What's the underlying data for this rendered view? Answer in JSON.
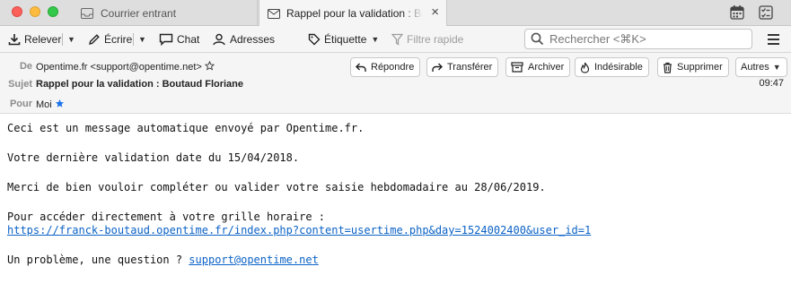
{
  "tabs": [
    {
      "label": "Courrier entrant",
      "active": false
    },
    {
      "label": "Rappel pour la validation : Bo",
      "active": true
    }
  ],
  "toolbar": {
    "get_messages": "Relever",
    "write": "Écrire",
    "chat": "Chat",
    "address_book": "Adresses",
    "tag": "Étiquette",
    "quick_filter": "Filtre rapide",
    "search_placeholder": "Rechercher <⌘K>"
  },
  "header": {
    "from_label": "De",
    "from_value": "Opentime.fr <support@opentime.net>",
    "subject_label": "Sujet",
    "subject_value": "Rappel pour la validation : Boutaud Floriane",
    "to_label": "Pour",
    "to_value": "Moi",
    "time": "09:47",
    "actions": {
      "reply": "Répondre",
      "forward": "Transférer",
      "archive": "Archiver",
      "junk": "Indésirable",
      "delete": "Supprimer",
      "more": "Autres"
    }
  },
  "body": {
    "line1": "Ceci est un message automatique envoyé par Opentime.fr.",
    "line2": "Votre dernière validation date du 15/04/2018.",
    "line3": "Merci de bien vouloir compléter ou valider votre saisie hebdomadaire au 28/06/2019.",
    "line4": "Pour accéder directement à votre grille horaire :",
    "link": "https://franck-boutaud.opentime.fr/index.php?content=usertime.php&day=1524002400&user_id=1",
    "line5_prefix": "Un problème, une question ? ",
    "support_link": "support@opentime.net"
  },
  "colors": {
    "link": "#0b62c6",
    "star": "#1a73e8",
    "close": "#fc605b",
    "minimize": "#fdbc40",
    "maximize": "#34c84a"
  }
}
